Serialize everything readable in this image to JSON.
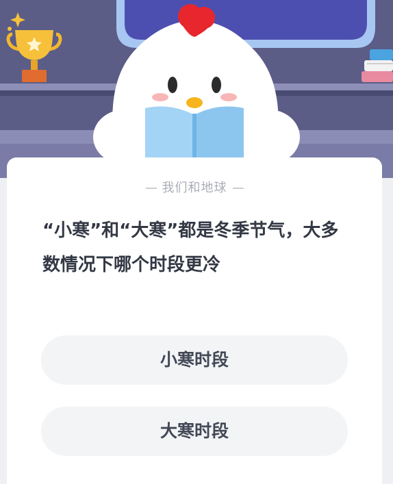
{
  "quiz": {
    "category": "我们和地球",
    "question": "“小寒”和“大寒”都是冬季节气，大多数情况下哪个时段更冷",
    "options": [
      {
        "label": "小寒时段"
      },
      {
        "label": "大寒时段"
      }
    ]
  },
  "illustration": {
    "icons": [
      "trophy-icon",
      "sparkle-icon",
      "book-stack-icon",
      "chick-mascot",
      "open-book-icon"
    ]
  },
  "colors": {
    "background": "#5d5f8a",
    "card": "#ffffff",
    "option_bg": "#f3f4f6",
    "question_text": "#333844",
    "category_text": "#a9adb5",
    "mascot_comb": "#e8262d",
    "book": "#9fd0f2"
  }
}
